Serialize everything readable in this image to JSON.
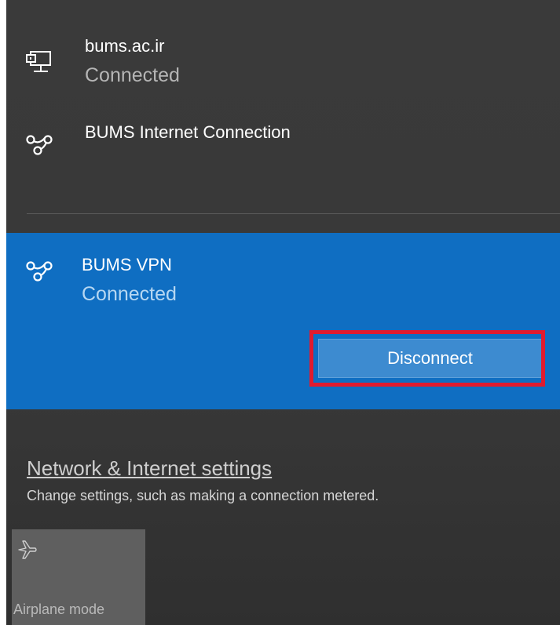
{
  "networks": [
    {
      "name": "bums.ac.ir",
      "status": "Connected",
      "icon": "ethernet-icon"
    },
    {
      "name": "BUMS Internet Connection",
      "status": "",
      "icon": "dialup-icon"
    }
  ],
  "vpn": {
    "name": "BUMS VPN",
    "status": "Connected",
    "icon": "vpn-icon",
    "disconnect_label": "Disconnect"
  },
  "settings": {
    "link_label": "Network & Internet settings",
    "description": "Change settings, such as making a connection metered."
  },
  "quick_actions": [
    {
      "label": "Airplane mode",
      "icon": "airplane-icon"
    }
  ],
  "colors": {
    "selected_background": "#0f6ec2",
    "button_background": "#3d8bd0",
    "highlight_border": "#e01b2f"
  }
}
